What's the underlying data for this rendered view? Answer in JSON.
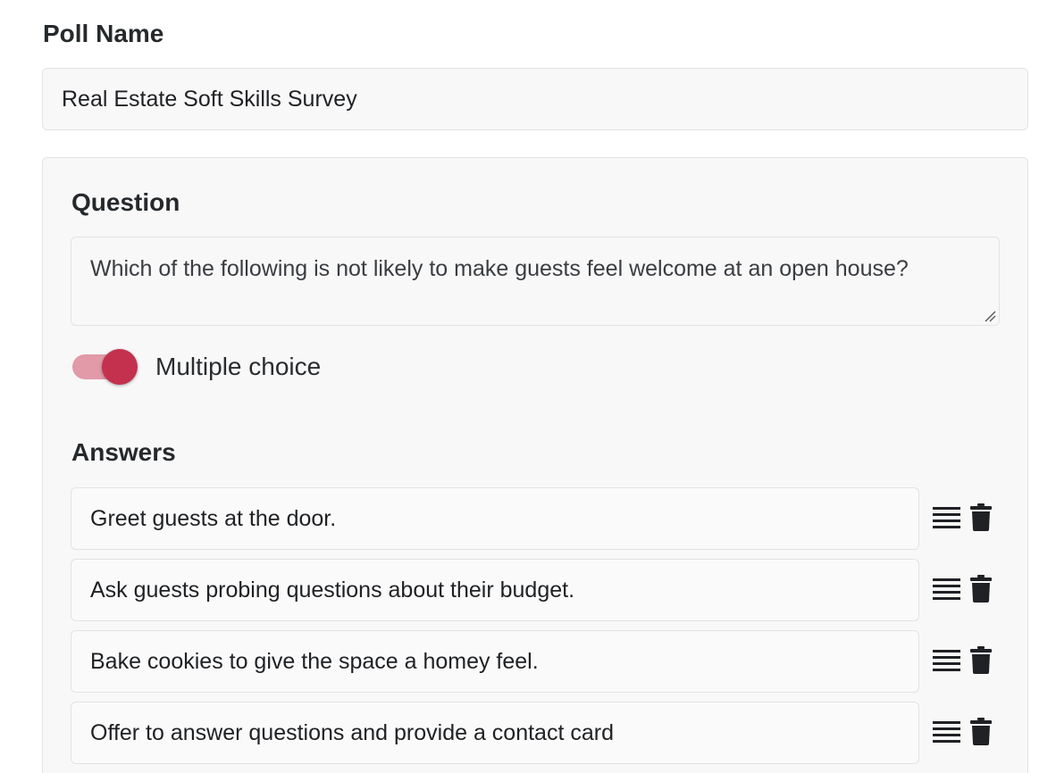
{
  "poll": {
    "name_label": "Poll Name",
    "name_value": "Real Estate Soft Skills Survey"
  },
  "question": {
    "label": "Question",
    "text": "Which of the following is not likely to make guests feel welcome at an open house?",
    "multiple_choice_label": "Multiple choice",
    "multiple_choice_enabled": true,
    "accent_color": "#c4314f"
  },
  "answers": {
    "label": "Answers",
    "items": [
      {
        "text": "Greet guests at the door."
      },
      {
        "text": "Ask guests probing questions about their budget."
      },
      {
        "text": "Bake cookies to give the space a homey feel."
      },
      {
        "text": "Offer to answer questions and provide a contact card"
      }
    ],
    "drag_icon": "drag-handle-icon",
    "delete_icon": "trash-icon"
  }
}
